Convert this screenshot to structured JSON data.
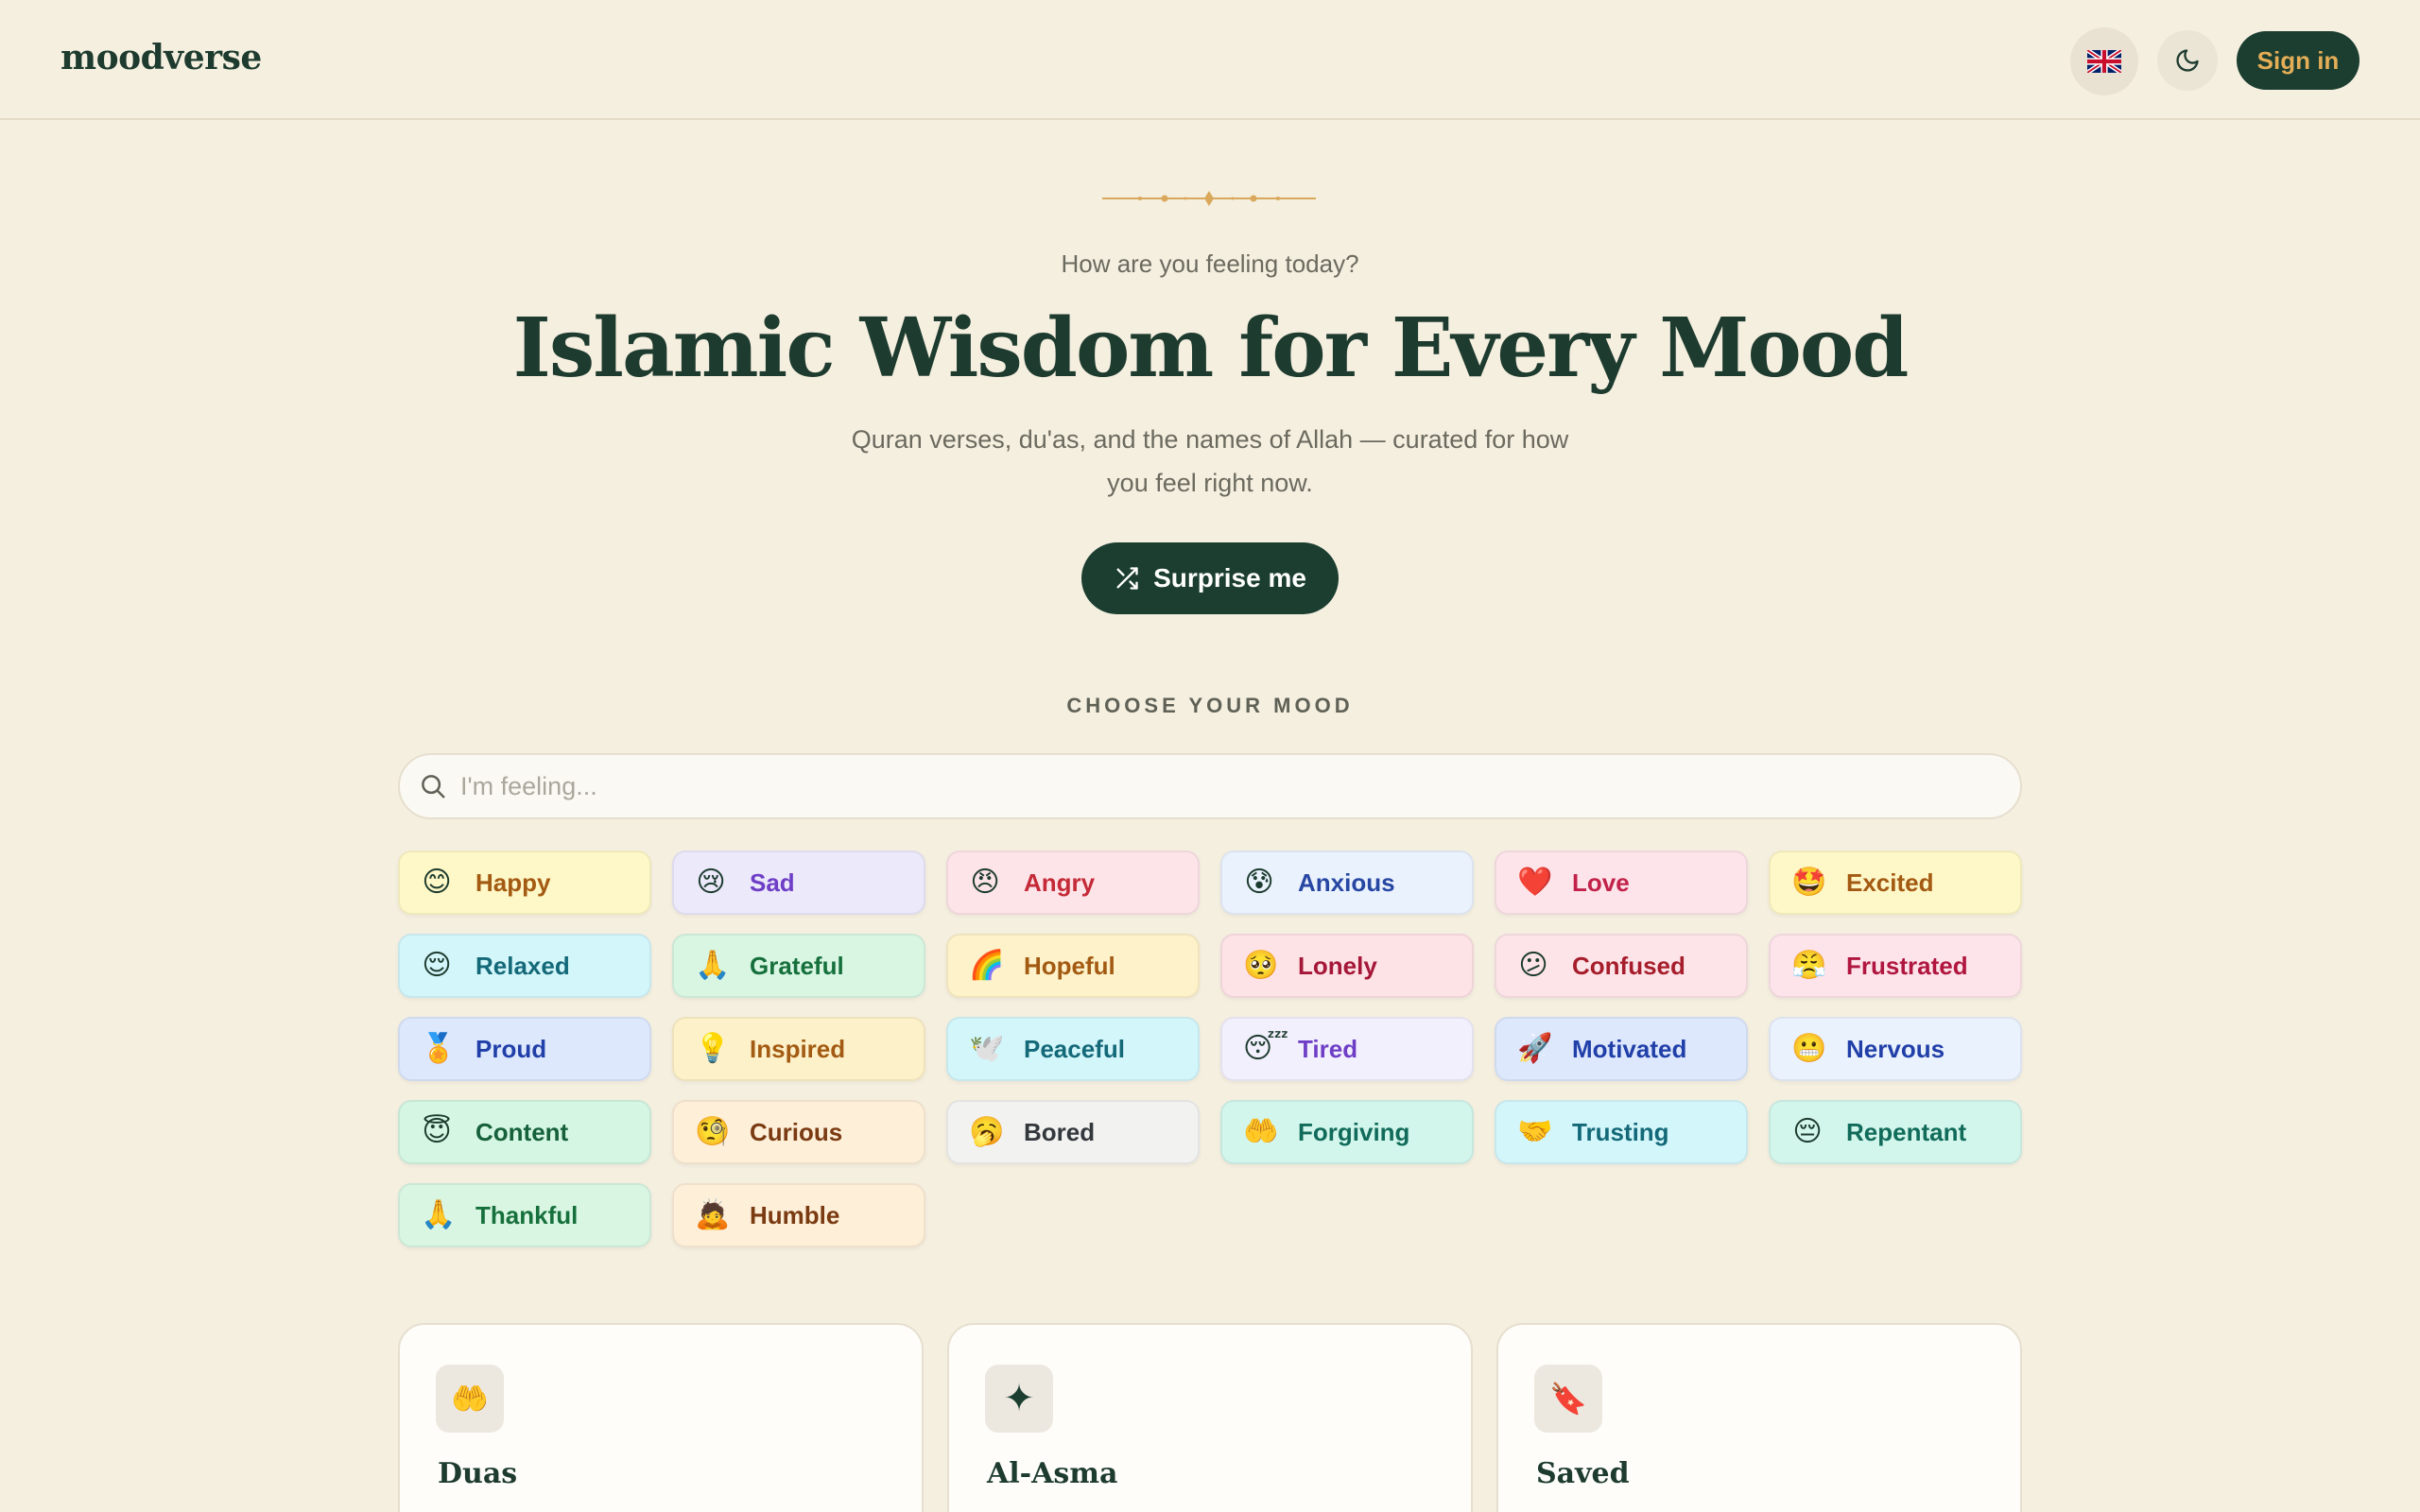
{
  "app": {
    "logo": "moodverse"
  },
  "header": {
    "language_icon": "uk-flag-icon",
    "theme_icon": "moon-icon",
    "signin_label": "Sign in"
  },
  "hero": {
    "kicker": "How are you feeling today?",
    "title": "Islamic Wisdom for Every Mood",
    "subtitle": "Quran verses, du'as, and the names of Allah — curated for how you feel right now.",
    "surprise_label": "Surprise me",
    "surprise_icon": "shuffle-icon"
  },
  "moods_section": {
    "label": "CHOOSE YOUR MOOD",
    "search_placeholder": "I'm feeling...",
    "search_value": ""
  },
  "moods": [
    {
      "label": "Happy",
      "emoji": "😊",
      "bg": "#fef7c7",
      "fg": "#a35a12"
    },
    {
      "label": "Sad",
      "emoji": "😢",
      "bg": "#ece9fb",
      "fg": "#6e3fc6"
    },
    {
      "label": "Angry",
      "emoji": "😠",
      "bg": "#fde4e8",
      "fg": "#c42a37"
    },
    {
      "label": "Anxious",
      "emoji": "😰",
      "bg": "#eaf2fd",
      "fg": "#2747a3"
    },
    {
      "label": "Love",
      "emoji": "❤️",
      "bg": "#fde4ea",
      "fg": "#c1224a"
    },
    {
      "label": "Excited",
      "emoji": "🤩",
      "bg": "#fef7c7",
      "fg": "#a35a12"
    },
    {
      "label": "Relaxed",
      "emoji": "😌",
      "bg": "#d3f6fa",
      "fg": "#146979"
    },
    {
      "label": "Grateful",
      "emoji": "🙏",
      "bg": "#d9f6e3",
      "fg": "#16703c"
    },
    {
      "label": "Hopeful",
      "emoji": "🌈",
      "bg": "#fdf2c9",
      "fg": "#a35a12"
    },
    {
      "label": "Lonely",
      "emoji": "🥺",
      "bg": "#fde2e6",
      "fg": "#a51738"
    },
    {
      "label": "Confused",
      "emoji": "😕",
      "bg": "#fde4e8",
      "fg": "#a61d2c"
    },
    {
      "label": "Frustrated",
      "emoji": "😤",
      "bg": "#fde4ea",
      "fg": "#b0163f"
    },
    {
      "label": "Proud",
      "emoji": "🏅",
      "bg": "#dde8fd",
      "fg": "#213fa8"
    },
    {
      "label": "Inspired",
      "emoji": "💡",
      "bg": "#fdf1c9",
      "fg": "#a35a12"
    },
    {
      "label": "Peaceful",
      "emoji": "🕊️",
      "bg": "#d3f6fa",
      "fg": "#146979"
    },
    {
      "label": "Tired",
      "emoji": "😴",
      "bg": "#f3f0fd",
      "fg": "#6e3fc6"
    },
    {
      "label": "Motivated",
      "emoji": "🚀",
      "bg": "#dde8fd",
      "fg": "#213fa8"
    },
    {
      "label": "Nervous",
      "emoji": "😬",
      "bg": "#eaf2fd",
      "fg": "#213fa8"
    },
    {
      "label": "Content",
      "emoji": "😇",
      "bg": "#d4f6e3",
      "fg": "#16603a"
    },
    {
      "label": "Curious",
      "emoji": "🧐",
      "bg": "#fdefd8",
      "fg": "#7a3a12"
    },
    {
      "label": "Bored",
      "emoji": "🥱",
      "bg": "#f2f2f1",
      "fg": "#33383d"
    },
    {
      "label": "Forgiving",
      "emoji": "🤲",
      "bg": "#d3f6ec",
      "fg": "#116b5a"
    },
    {
      "label": "Trusting",
      "emoji": "🤝",
      "bg": "#d3f6fa",
      "fg": "#146979"
    },
    {
      "label": "Repentant",
      "emoji": "😔",
      "bg": "#d3f6ec",
      "fg": "#116b5a"
    },
    {
      "label": "Thankful",
      "emoji": "🙏",
      "bg": "#d9f6e3",
      "fg": "#16703c"
    },
    {
      "label": "Humble",
      "emoji": "🙇",
      "bg": "#fdefd8",
      "fg": "#7a3a12"
    }
  ],
  "cards": [
    {
      "title": "Duas",
      "icon": "open-hands-icon",
      "glyph": "🤲"
    },
    {
      "title": "Al-Asma",
      "icon": "sparkle-icon",
      "glyph": "✦"
    },
    {
      "title": "Saved",
      "icon": "bookmark-icon",
      "glyph": "🔖"
    }
  ],
  "colors": {
    "background": "#f5efe0",
    "primary": "#1b3e30",
    "accent_gold": "#e4ad57",
    "ornament": "#d9a85a"
  }
}
